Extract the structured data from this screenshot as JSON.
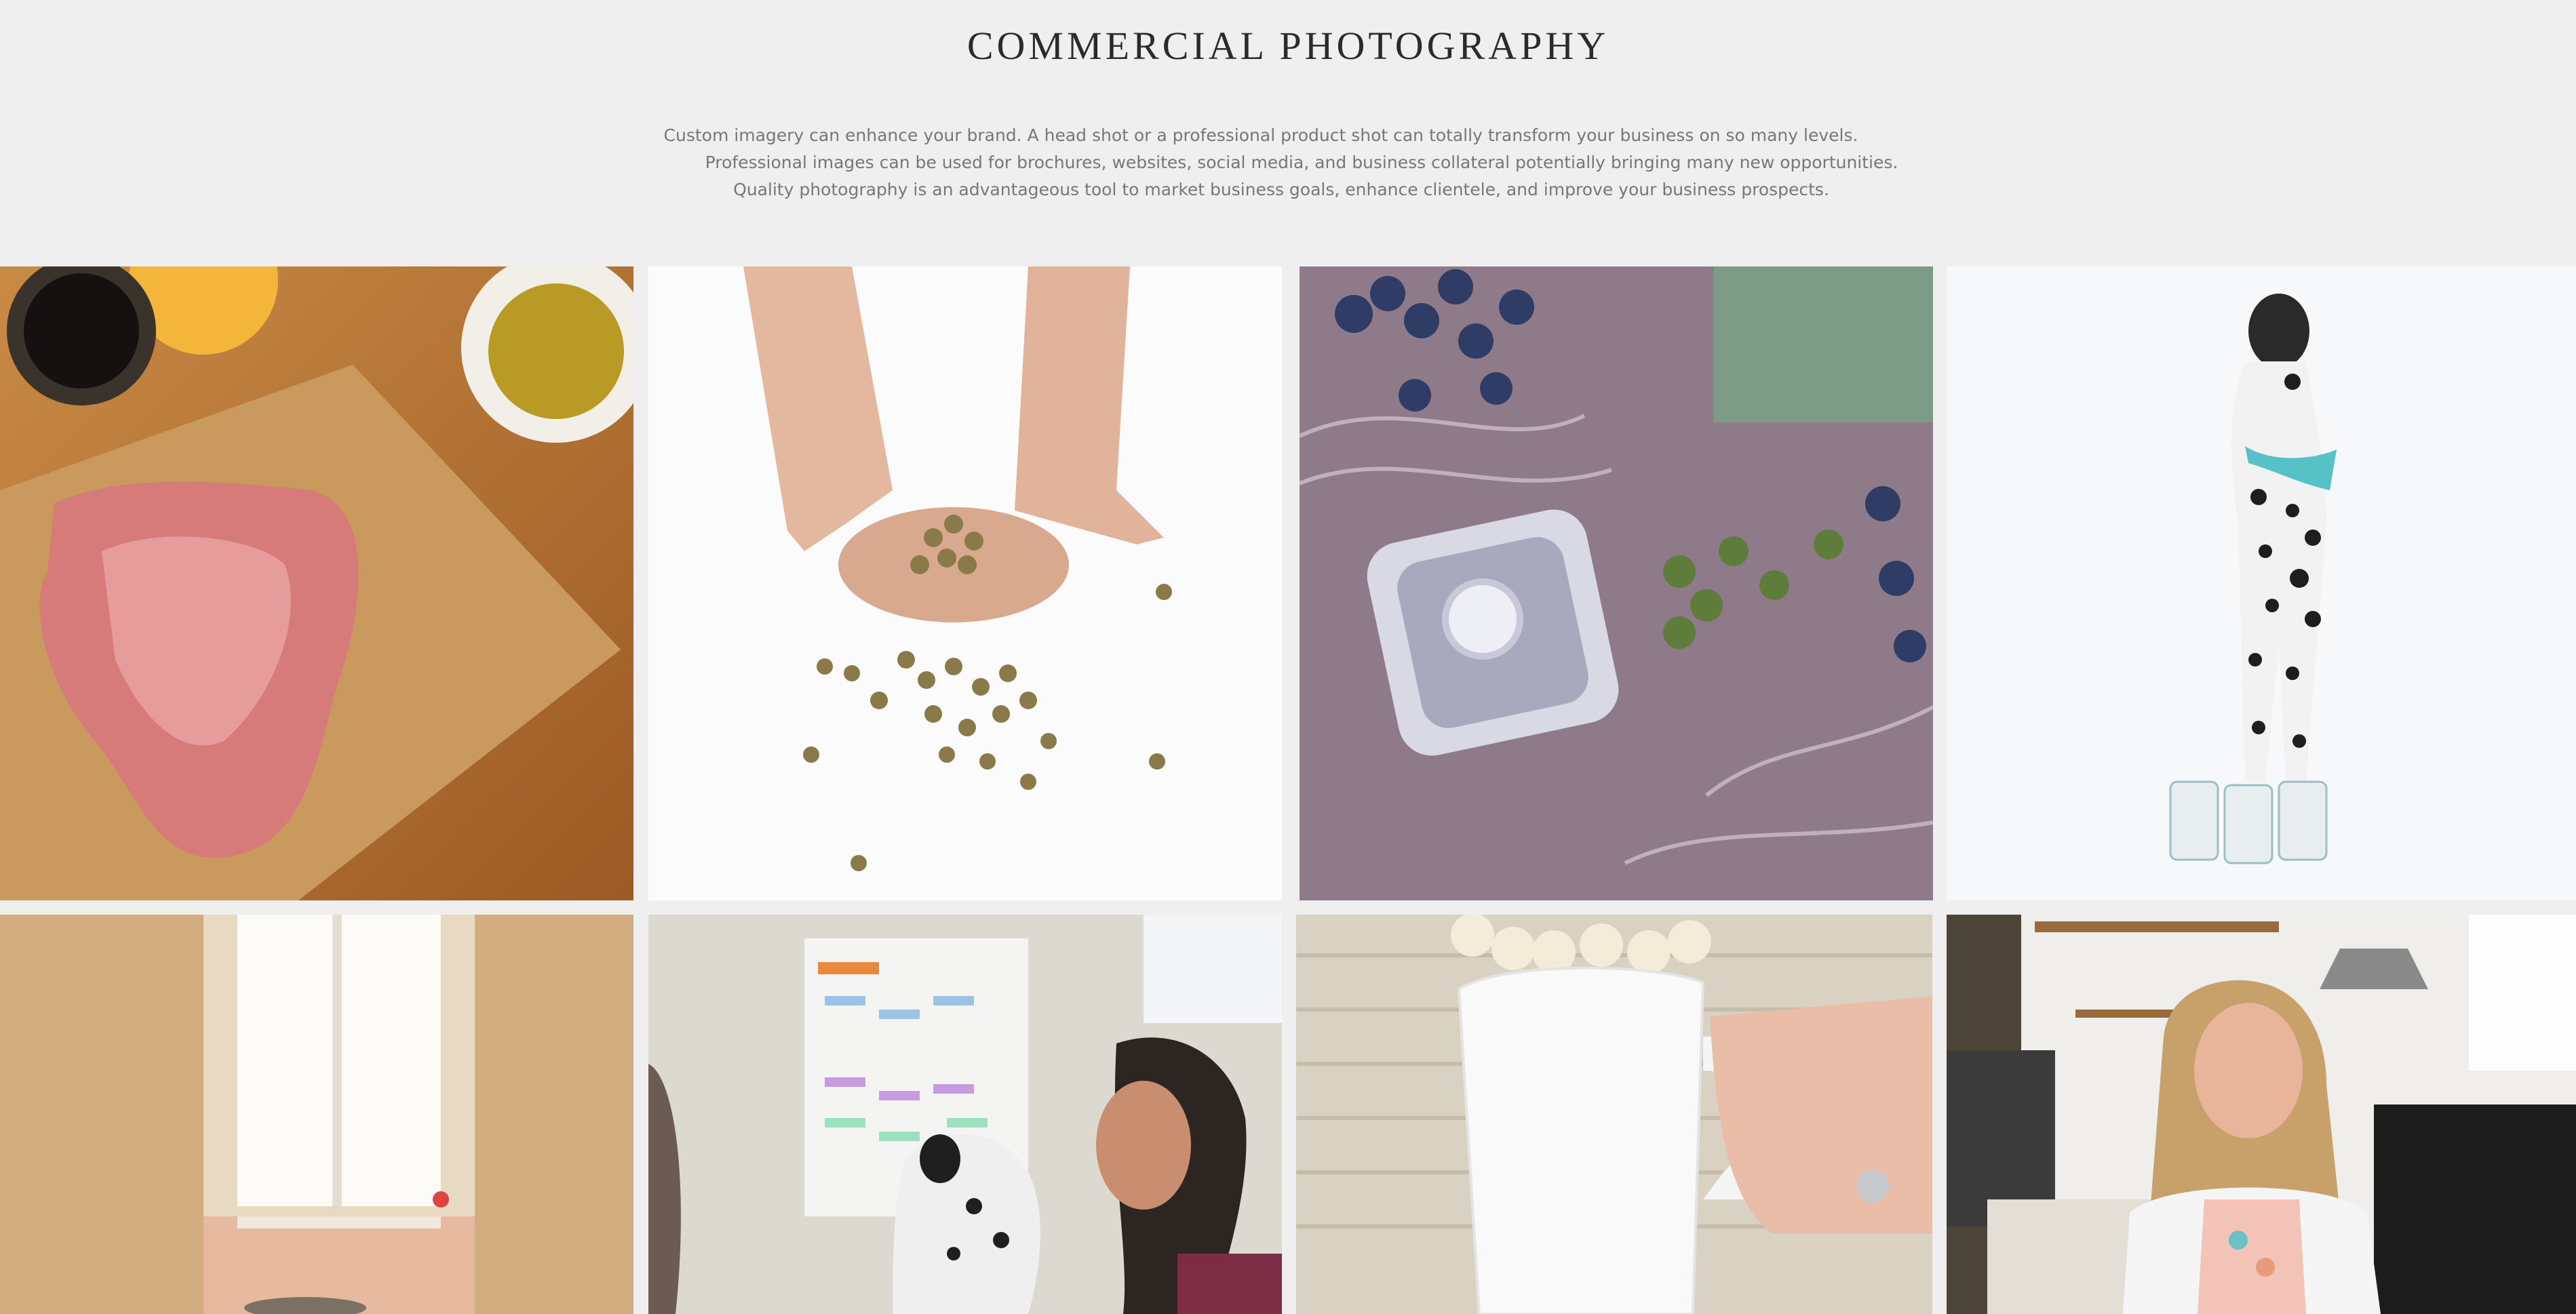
{
  "header": {
    "title": "COMMERCIAL PHOTOGRAPHY"
  },
  "intro": {
    "line1": "Custom imagery can enhance your brand.  A head shot or a professional product shot can totally transform your business on so many levels.",
    "line2": "Professional images can be used for brochures, websites, social media, and business collateral potentially bringing many new opportunities.",
    "line3": "Quality photography is an advantageous tool to market business goals, enhance clientele, and improve your business prospects."
  },
  "gallery": {
    "columns": 4,
    "photos": [
      {
        "subject": "raw-meat-on-cutting-board"
      },
      {
        "subject": "hands-holding-pet-food"
      },
      {
        "subject": "engagement-ring-box"
      },
      {
        "subject": "dalmatian-on-pet-food-cans"
      },
      {
        "subject": "window-room-table"
      },
      {
        "subject": "women-with-dalmatian"
      },
      {
        "subject": "hand-holding-white-mug"
      },
      {
        "subject": "smiling-woman-in-kitchen"
      }
    ]
  }
}
